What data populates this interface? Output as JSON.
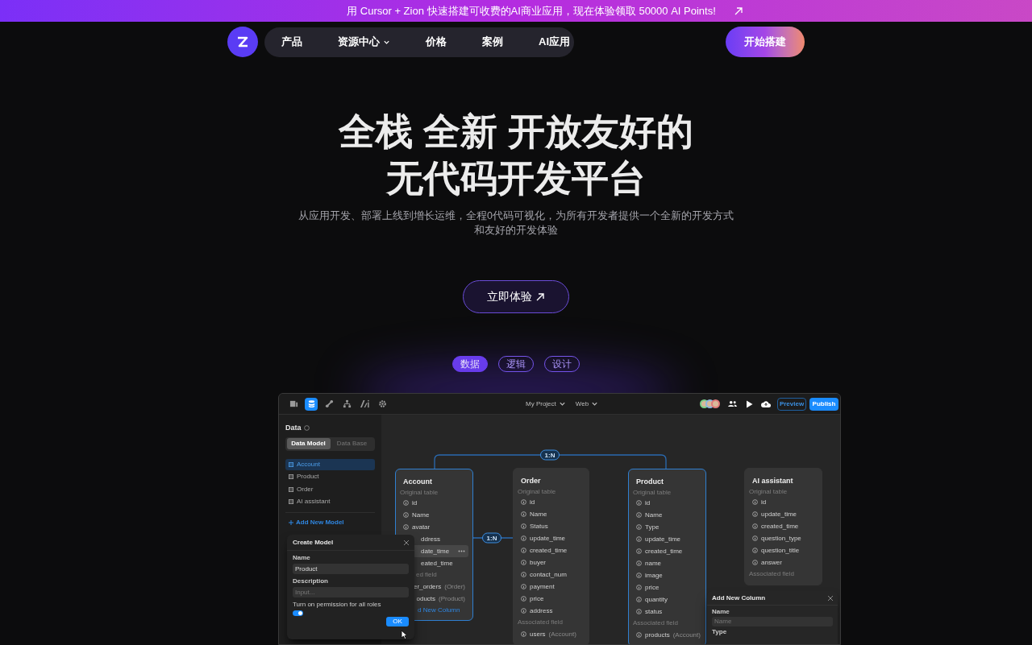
{
  "banner": {
    "text": "用 Cursor + Zion 快速搭建可收费的AI商业应用，现在体验领取 50000 AI Points!"
  },
  "nav": {
    "items": [
      {
        "label": "产品",
        "dropdown": false
      },
      {
        "label": "资源中心",
        "dropdown": true
      },
      {
        "label": "价格",
        "dropdown": false
      },
      {
        "label": "案例",
        "dropdown": false
      },
      {
        "label": "AI应用",
        "dropdown": false
      }
    ],
    "cta": "开始搭建"
  },
  "hero": {
    "title_lines": [
      "全栈 全新 开放友好的",
      "无代码开发平台"
    ],
    "subtitle_lines": [
      "从应用开发、部署上线到增长运维，全程0代码可视化，为所有开发者提供一个全新的开发方式",
      "和友好的开发体验"
    ],
    "button": "立即体验"
  },
  "feature_tabs": [
    {
      "label": "数据",
      "selected": true
    },
    {
      "label": "逻辑",
      "selected": false
    },
    {
      "label": "设计",
      "selected": false
    }
  ],
  "app": {
    "tools": [
      {
        "selected": false
      },
      {
        "selected": true
      },
      {
        "selected": false
      },
      {
        "selected": false
      },
      {
        "selected": false
      },
      {
        "selected": false
      }
    ],
    "project": "My Project",
    "platform": "Web",
    "preview": "Preview",
    "publish": "Publish",
    "sidebar": {
      "title": "Data",
      "tabs": [
        {
          "label": "Data Model",
          "selected": true
        },
        {
          "label": "Data Base",
          "selected": false
        }
      ],
      "models": [
        {
          "label": "Account",
          "selected": true
        },
        {
          "label": "Product",
          "selected": false
        },
        {
          "label": "Order",
          "selected": false
        },
        {
          "label": "AI assistant",
          "selected": false
        }
      ],
      "add": "Add New Model"
    },
    "relations": [
      {
        "label": "1:N"
      },
      {
        "label": "1:N"
      }
    ],
    "cards": [
      {
        "title": "Account",
        "highlighted": true,
        "subtitle": "Original table",
        "fields": [
          {
            "name": "id",
            "partial": false,
            "highlighted": false
          },
          {
            "name": "Name",
            "partial": false,
            "highlighted": false
          },
          {
            "name": "avatar",
            "partial": false,
            "highlighted": false
          },
          {
            "name": "ddress",
            "partial": true,
            "highlighted": false
          },
          {
            "name": "date_time",
            "partial": true,
            "highlighted": true
          },
          {
            "name": "eated_time",
            "partial": true,
            "highlighted": false
          }
        ],
        "associated_label": "ed field",
        "associated": [
          {
            "name": "er_orders",
            "ref": "(Order)",
            "partial": true
          },
          {
            "name": "oducts",
            "ref": "(Product)",
            "partial": true
          }
        ],
        "add_column": "d New Column"
      },
      {
        "title": "Order",
        "highlighted": false,
        "subtitle": "Original table",
        "fields": [
          {
            "name": "id",
            "partial": false,
            "highlighted": false
          },
          {
            "name": "Name",
            "partial": false,
            "highlighted": false
          },
          {
            "name": "Status",
            "partial": false,
            "highlighted": false
          },
          {
            "name": "update_time",
            "partial": false,
            "highlighted": false
          },
          {
            "name": "created_time",
            "partial": false,
            "highlighted": false
          },
          {
            "name": "buyer",
            "partial": false,
            "highlighted": false
          },
          {
            "name": "contact_num",
            "partial": false,
            "highlighted": false
          },
          {
            "name": "payment",
            "partial": false,
            "highlighted": false
          },
          {
            "name": "price",
            "partial": false,
            "highlighted": false
          },
          {
            "name": "address",
            "partial": false,
            "highlighted": false
          }
        ],
        "associated_label": "Associated field",
        "associated": [
          {
            "name": "users",
            "ref": "(Account)",
            "partial": false
          }
        ]
      },
      {
        "title": "Product",
        "highlighted": true,
        "subtitle": "Original table",
        "fields": [
          {
            "name": "id",
            "partial": false,
            "highlighted": false
          },
          {
            "name": "Name",
            "partial": false,
            "highlighted": false
          },
          {
            "name": "Type",
            "partial": false,
            "highlighted": false
          },
          {
            "name": "update_time",
            "partial": false,
            "highlighted": false
          },
          {
            "name": "created_time",
            "partial": false,
            "highlighted": false
          },
          {
            "name": "name",
            "partial": false,
            "highlighted": false
          },
          {
            "name": "image",
            "partial": false,
            "highlighted": false
          },
          {
            "name": "price",
            "partial": false,
            "highlighted": false
          },
          {
            "name": "quantity",
            "partial": false,
            "highlighted": false
          },
          {
            "name": "status",
            "partial": false,
            "highlighted": false
          }
        ],
        "associated_label": "Associated field",
        "associated": [
          {
            "name": "products",
            "ref": "(Account)",
            "partial": false
          }
        ]
      },
      {
        "title": "AI assistant",
        "highlighted": false,
        "subtitle": "Original table",
        "fields": [
          {
            "name": "id",
            "partial": false,
            "highlighted": false
          },
          {
            "name": "update_time",
            "partial": false,
            "highlighted": false
          },
          {
            "name": "created_time",
            "partial": false,
            "highlighted": false
          },
          {
            "name": "question_type",
            "partial": false,
            "highlighted": false
          },
          {
            "name": "question_title",
            "partial": false,
            "highlighted": false
          },
          {
            "name": "answer",
            "partial": false,
            "highlighted": false
          }
        ],
        "associated_label": "Associated field"
      }
    ],
    "create_dialog": {
      "title": "Create Model",
      "name_label": "Name",
      "name_value": "Product",
      "desc_label": "Description",
      "desc_placeholder": "Input...",
      "permission_label": "Turn on permission for all roles",
      "permission_on": true,
      "ok": "OK"
    },
    "column_dialog": {
      "title": "Add New Column",
      "name_label": "Name",
      "name_placeholder": "Name",
      "type_label": "Type"
    }
  }
}
